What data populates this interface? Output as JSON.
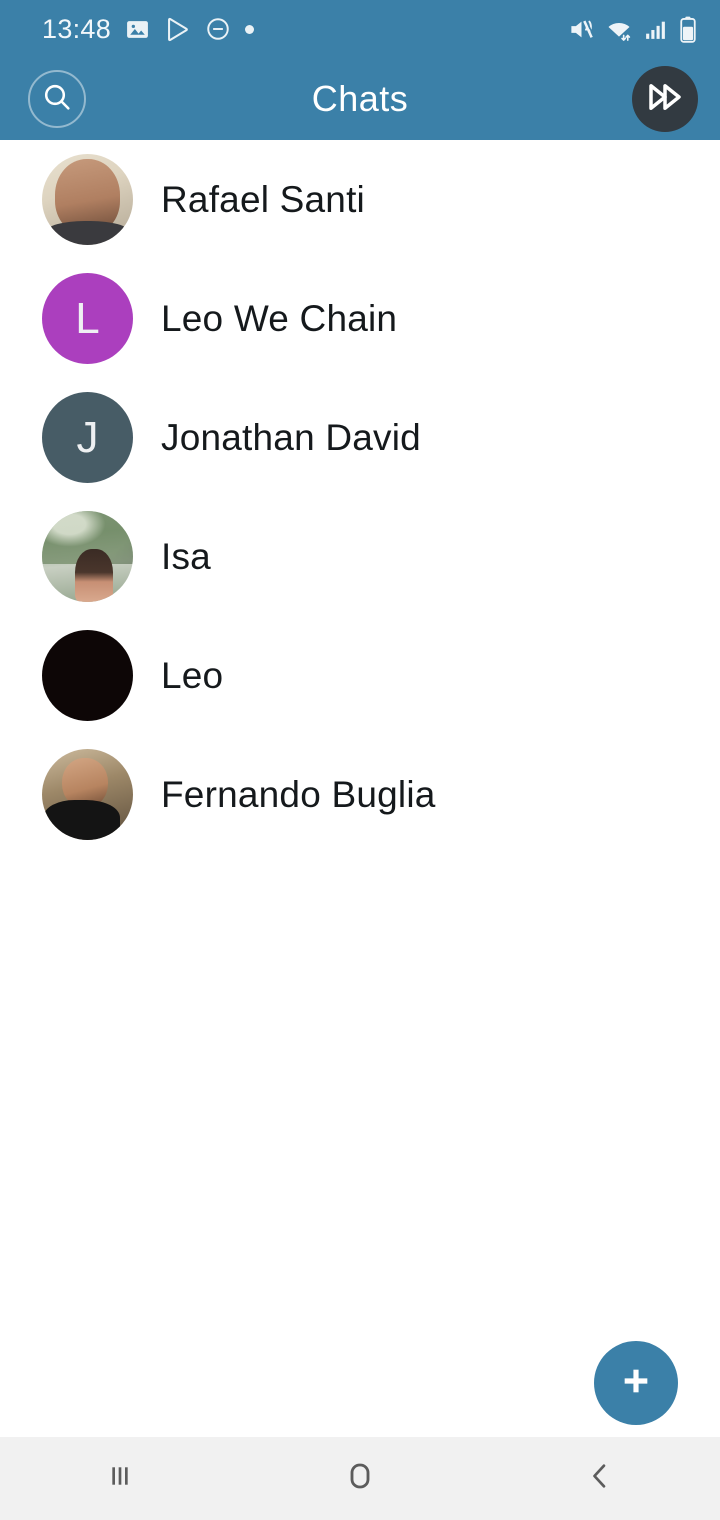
{
  "status_bar": {
    "time": "13:48",
    "left_icons": [
      "image-icon",
      "play-store-icon",
      "do-not-disturb-icon",
      "dot-indicator-icon"
    ],
    "right_icons": [
      "mute-vibrate-icon",
      "wifi-icon",
      "cellular-signal-icon",
      "battery-icon"
    ],
    "background_color": "#3b80a8",
    "foreground_color": "#ffffff"
  },
  "app_bar": {
    "title": "Chats",
    "search_icon": "search-icon",
    "forward_icon": "fast-forward-icon",
    "background_color": "#3b80a8",
    "forward_button_color": "#323a41"
  },
  "chats": [
    {
      "name": "Rafael Santi",
      "avatar_type": "photo",
      "avatar_style": "ph-rafael",
      "initial": "",
      "avatar_color": "#ded4c0"
    },
    {
      "name": "Leo We Chain",
      "avatar_type": "initial",
      "avatar_style": "",
      "initial": "L",
      "avatar_color": "#ab3fbe"
    },
    {
      "name": "Jonathan David",
      "avatar_type": "initial",
      "avatar_style": "",
      "initial": "J",
      "avatar_color": "#475c66"
    },
    {
      "name": "Isa",
      "avatar_type": "photo",
      "avatar_style": "ph-isa",
      "initial": "",
      "avatar_color": "#8aa383"
    },
    {
      "name": "Leo",
      "avatar_type": "solid",
      "avatar_style": "",
      "initial": "",
      "avatar_color": "#0d0606"
    },
    {
      "name": "Fernando Buglia",
      "avatar_type": "photo",
      "avatar_style": "ph-fernando",
      "initial": "",
      "avatar_color": "#9d8868"
    }
  ],
  "fab": {
    "icon": "plus-icon",
    "color": "#3b80a8"
  },
  "nav_bar": {
    "background_color": "#f1f1f1",
    "buttons": [
      {
        "name": "recents-button",
        "icon": "recents-icon"
      },
      {
        "name": "home-button",
        "icon": "home-icon"
      },
      {
        "name": "back-button",
        "icon": "back-chevron-icon"
      }
    ]
  }
}
